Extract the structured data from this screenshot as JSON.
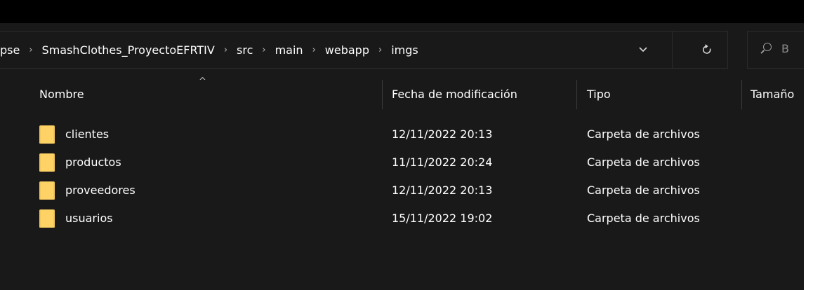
{
  "address_bar": {
    "breadcrumb": [
      "pse",
      "SmashClothes_ProyectoEFRTIV",
      "src",
      "main",
      "webapp",
      "imgs"
    ],
    "separator": "›",
    "dropdown_icon": "chevron-down-icon",
    "refresh_icon": "refresh-icon"
  },
  "search": {
    "icon": "search-icon",
    "placeholder": "B"
  },
  "columns": {
    "name": "Nombre",
    "date": "Fecha de modificación",
    "type": "Tipo",
    "size": "Tamaño",
    "sort_indicator": "^"
  },
  "files": [
    {
      "name": "clientes",
      "date": "12/11/2022 20:13",
      "type": "Carpeta de archivos",
      "icon": "folder-icon"
    },
    {
      "name": "productos",
      "date": "11/11/2022 20:24",
      "type": "Carpeta de archivos",
      "icon": "folder-icon"
    },
    {
      "name": "proveedores",
      "date": "12/11/2022 20:13",
      "type": "Carpeta de archivos",
      "icon": "folder-icon"
    },
    {
      "name": "usuarios",
      "date": "15/11/2022 19:02",
      "type": "Carpeta de archivos",
      "icon": "folder-icon"
    }
  ],
  "colors": {
    "background": "#191919",
    "folder": "#ffd266",
    "text": "#ffffff"
  }
}
